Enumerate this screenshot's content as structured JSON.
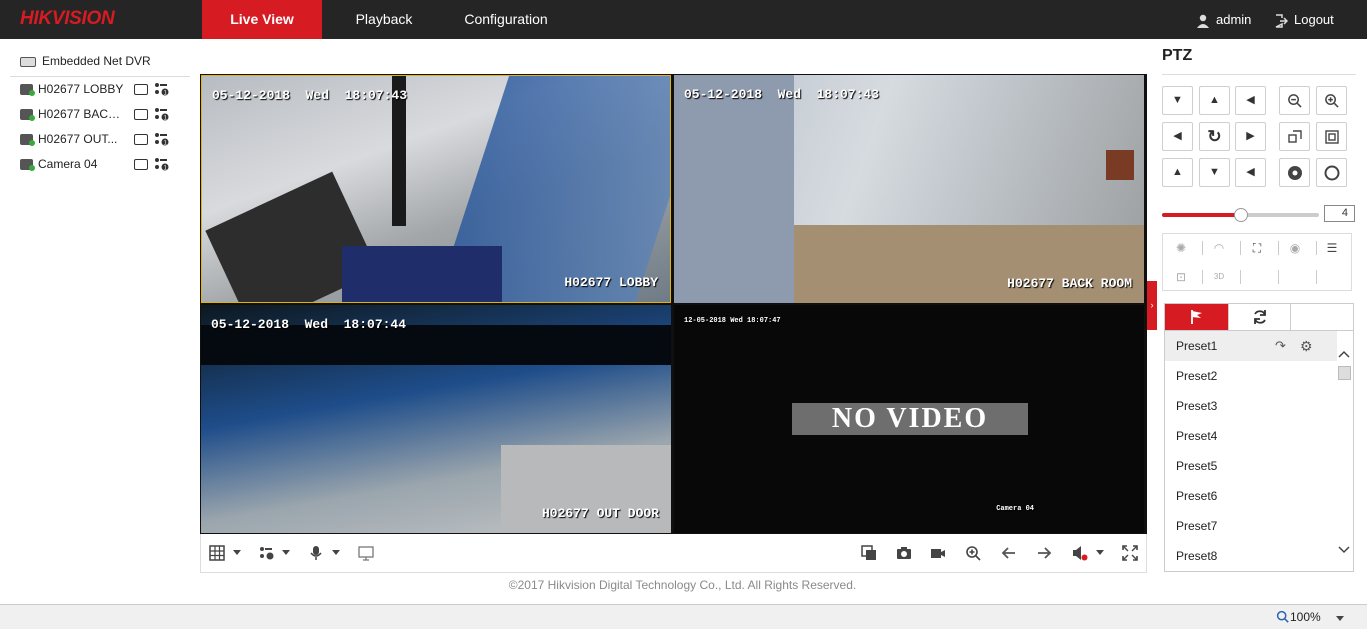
{
  "app": {
    "logo": "HIKVISION",
    "nav": [
      "Live View",
      "Playback",
      "Configuration"
    ],
    "user": "admin",
    "logout": "Logout"
  },
  "tree": {
    "root": "Embedded Net DVR",
    "cameras": [
      "H02677 LOBBY",
      "H02677 BACK...",
      "H02677 OUT...",
      "Camera 04"
    ]
  },
  "video": {
    "tiles": [
      {
        "time": "05-12-2018  Wed  18:07:43",
        "name": "H02677 LOBBY"
      },
      {
        "time": "05-12-2018  Wed  18:07:43",
        "name": "H02677 BACK ROOM"
      },
      {
        "time": "05-12-2018  Wed  18:07:44",
        "name": "H02677 OUT DOOR"
      },
      {
        "time": "12-05-2018 Wed 18:07:47",
        "name": "Camera 04",
        "overlay": "NO VIDEO"
      }
    ]
  },
  "footer": {
    "copyright": "©2017 Hikvision Digital Technology Co., Ltd. All Rights Reserved."
  },
  "ptz": {
    "title": "PTZ",
    "speed": "4",
    "speed_level": 0.5,
    "presets": [
      "Preset1",
      "Preset2",
      "Preset3",
      "Preset4",
      "Preset5",
      "Preset6",
      "Preset7",
      "Preset8"
    ]
  },
  "status": {
    "zoom": "100%"
  },
  "colors": {
    "accent": "#d71b23",
    "topbar": "#252525",
    "selected_border": "#e2b400"
  }
}
